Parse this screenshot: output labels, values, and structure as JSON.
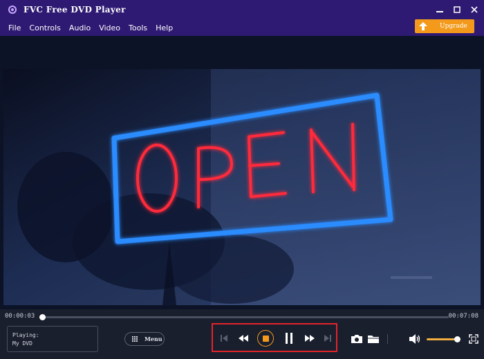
{
  "window": {
    "title": "FVC Free DVD Player",
    "minimize_glyph": "▬",
    "maximize_glyph": "☐",
    "close_glyph": "✕"
  },
  "menu": {
    "items": [
      "File",
      "Controls",
      "Audio",
      "Video",
      "Tools",
      "Help"
    ]
  },
  "upgrade": {
    "label": "Upgrade",
    "icon": "upload-arrow-icon"
  },
  "video": {
    "sign_text": "OPEN",
    "neon_red": "#ff2a3a",
    "neon_blue": "#2a8cff"
  },
  "playback": {
    "current_time": "00:00:03",
    "total_time": "00:07:08",
    "progress_fraction": 0.007
  },
  "now_playing": {
    "label": "Playing:",
    "title": "My DVD"
  },
  "menu_button": {
    "label": "Menu",
    "icon": "grid-icon"
  },
  "transport": {
    "buttons": [
      "skip-previous-icon",
      "rewind-icon",
      "stop-icon",
      "pause-icon",
      "fast-forward-icon",
      "skip-next-icon"
    ]
  },
  "tools": [
    "camera-icon",
    "folder-icon"
  ],
  "volume": {
    "level_fraction": 0.92,
    "icon": "volume-icon"
  },
  "fullscreen": {
    "icon": "fullscreen-icon"
  },
  "colors": {
    "titlebar": "#2e1a73",
    "accent": "#f39a1c",
    "highlight_box": "#e5232a",
    "panel": "#1a1f2e"
  }
}
